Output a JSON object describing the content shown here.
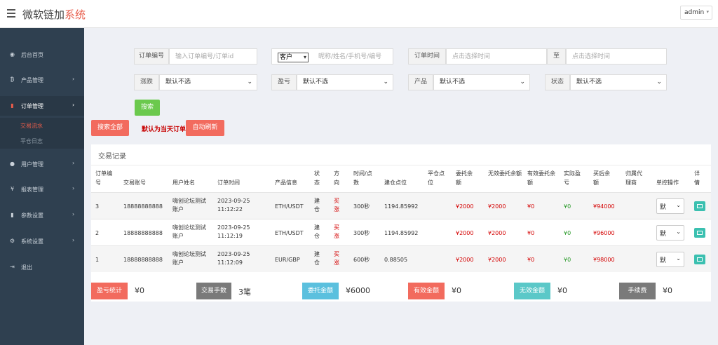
{
  "header": {
    "brand_main": "微软链加",
    "brand_accent": "系统",
    "user": "admin"
  },
  "sidebar": {
    "items": [
      {
        "label": "后台首页",
        "icon": "dashboard-icon",
        "glyph": "◉"
      },
      {
        "label": "产品管理",
        "icon": "bitcoin-icon",
        "glyph": "₿"
      },
      {
        "label": "订单管理",
        "icon": "orders-icon",
        "glyph": "▮"
      },
      {
        "label": "用户管理",
        "icon": "user-icon",
        "glyph": "●"
      },
      {
        "label": "报表管理",
        "icon": "yen-icon",
        "glyph": "¥"
      },
      {
        "label": "参数设置",
        "icon": "settings-copy-icon",
        "glyph": "▮"
      },
      {
        "label": "系统设置",
        "icon": "gears-icon",
        "glyph": "⚙"
      },
      {
        "label": "退出",
        "icon": "logout-icon",
        "glyph": "⇥"
      }
    ],
    "sub": [
      {
        "label": "交易流水"
      },
      {
        "label": "平仓日志"
      }
    ],
    "arrow": "›"
  },
  "filters": {
    "order_no_label": "订单编号",
    "order_no_placeholder": "输入订单编号/订单id",
    "customer_select": "客户",
    "customer_placeholder": "昵称/姓名/手机号/编号",
    "order_time_label": "订单时间",
    "order_time_placeholder": "点击选择时间",
    "to_label": "至",
    "to_placeholder": "点击选择时间",
    "rise_fall_label": "涨跌",
    "rise_fall_value": "默认不选",
    "profit_label": "盈亏",
    "profit_value": "默认不选",
    "product_label": "产品",
    "product_value": "默认不选",
    "status_label": "状态",
    "status_value": "默认不选",
    "search_button": "搜索",
    "search_all_button": "搜索全部",
    "default_notice": "默认为当天订单",
    "auto_refresh_button": "自动刷新"
  },
  "table": {
    "title": "交易记录",
    "headers": [
      "订单编号",
      "交易账号",
      "用户姓名",
      "订单时间",
      "产品信息",
      "状态",
      "方向",
      "时间/点数",
      "建仓点位",
      "平仓点位",
      "委托余额",
      "无效委托余额",
      "有效委托余额",
      "实际盈亏",
      "买后余额",
      "归属代理商",
      "单控操作",
      "详情"
    ],
    "rows": [
      {
        "id": "3",
        "account": "18888888888",
        "name": "嗨创论坛测试账户",
        "date": "2023-09-25",
        "time": "11:12:22",
        "product": "ETH/USDT",
        "status": "建仓",
        "direction": "买涨",
        "duration": "300秒",
        "open": "1194.85992",
        "close": "",
        "entrust": "¥2000",
        "invalid": "¥2000",
        "valid": "¥0",
        "pnl": "¥0",
        "after": "¥94000",
        "agent": "",
        "control": "默"
      },
      {
        "id": "2",
        "account": "18888888888",
        "name": "嗨创论坛测试账户",
        "date": "2023-09-25",
        "time": "11:12:19",
        "product": "ETH/USDT",
        "status": "建仓",
        "direction": "买涨",
        "duration": "300秒",
        "open": "1194.85992",
        "close": "",
        "entrust": "¥2000",
        "invalid": "¥2000",
        "valid": "¥0",
        "pnl": "¥0",
        "after": "¥96000",
        "agent": "",
        "control": "默"
      },
      {
        "id": "1",
        "account": "18888888888",
        "name": "嗨创论坛测试账户",
        "date": "2023-09-25",
        "time": "11:12:09",
        "product": "EUR/GBP",
        "status": "建仓",
        "direction": "买涨",
        "duration": "600秒",
        "open": "0.88505",
        "close": "",
        "entrust": "¥2000",
        "invalid": "¥2000",
        "valid": "¥0",
        "pnl": "¥0",
        "after": "¥98000",
        "agent": "",
        "control": "默"
      }
    ]
  },
  "stats": [
    {
      "label": "盈亏统计",
      "value": "¥0",
      "color": "#f26b5e"
    },
    {
      "label": "交易手数",
      "value": "3笔",
      "color": "#7a7a7a"
    },
    {
      "label": "委托金额",
      "value": "¥6000",
      "color": "#5bc0de"
    },
    {
      "label": "有效金额",
      "value": "¥0",
      "color": "#f26b5e"
    },
    {
      "label": "无效金额",
      "value": "¥0",
      "color": "#5bc8c8"
    },
    {
      "label": "手续费",
      "value": "¥0",
      "color": "#7a7a7a"
    }
  ],
  "colors": {
    "sidebar": "#2f4050",
    "accent": "#e85c4a",
    "green_btn": "#6bc94d",
    "red_btn": "#f26b5e"
  }
}
